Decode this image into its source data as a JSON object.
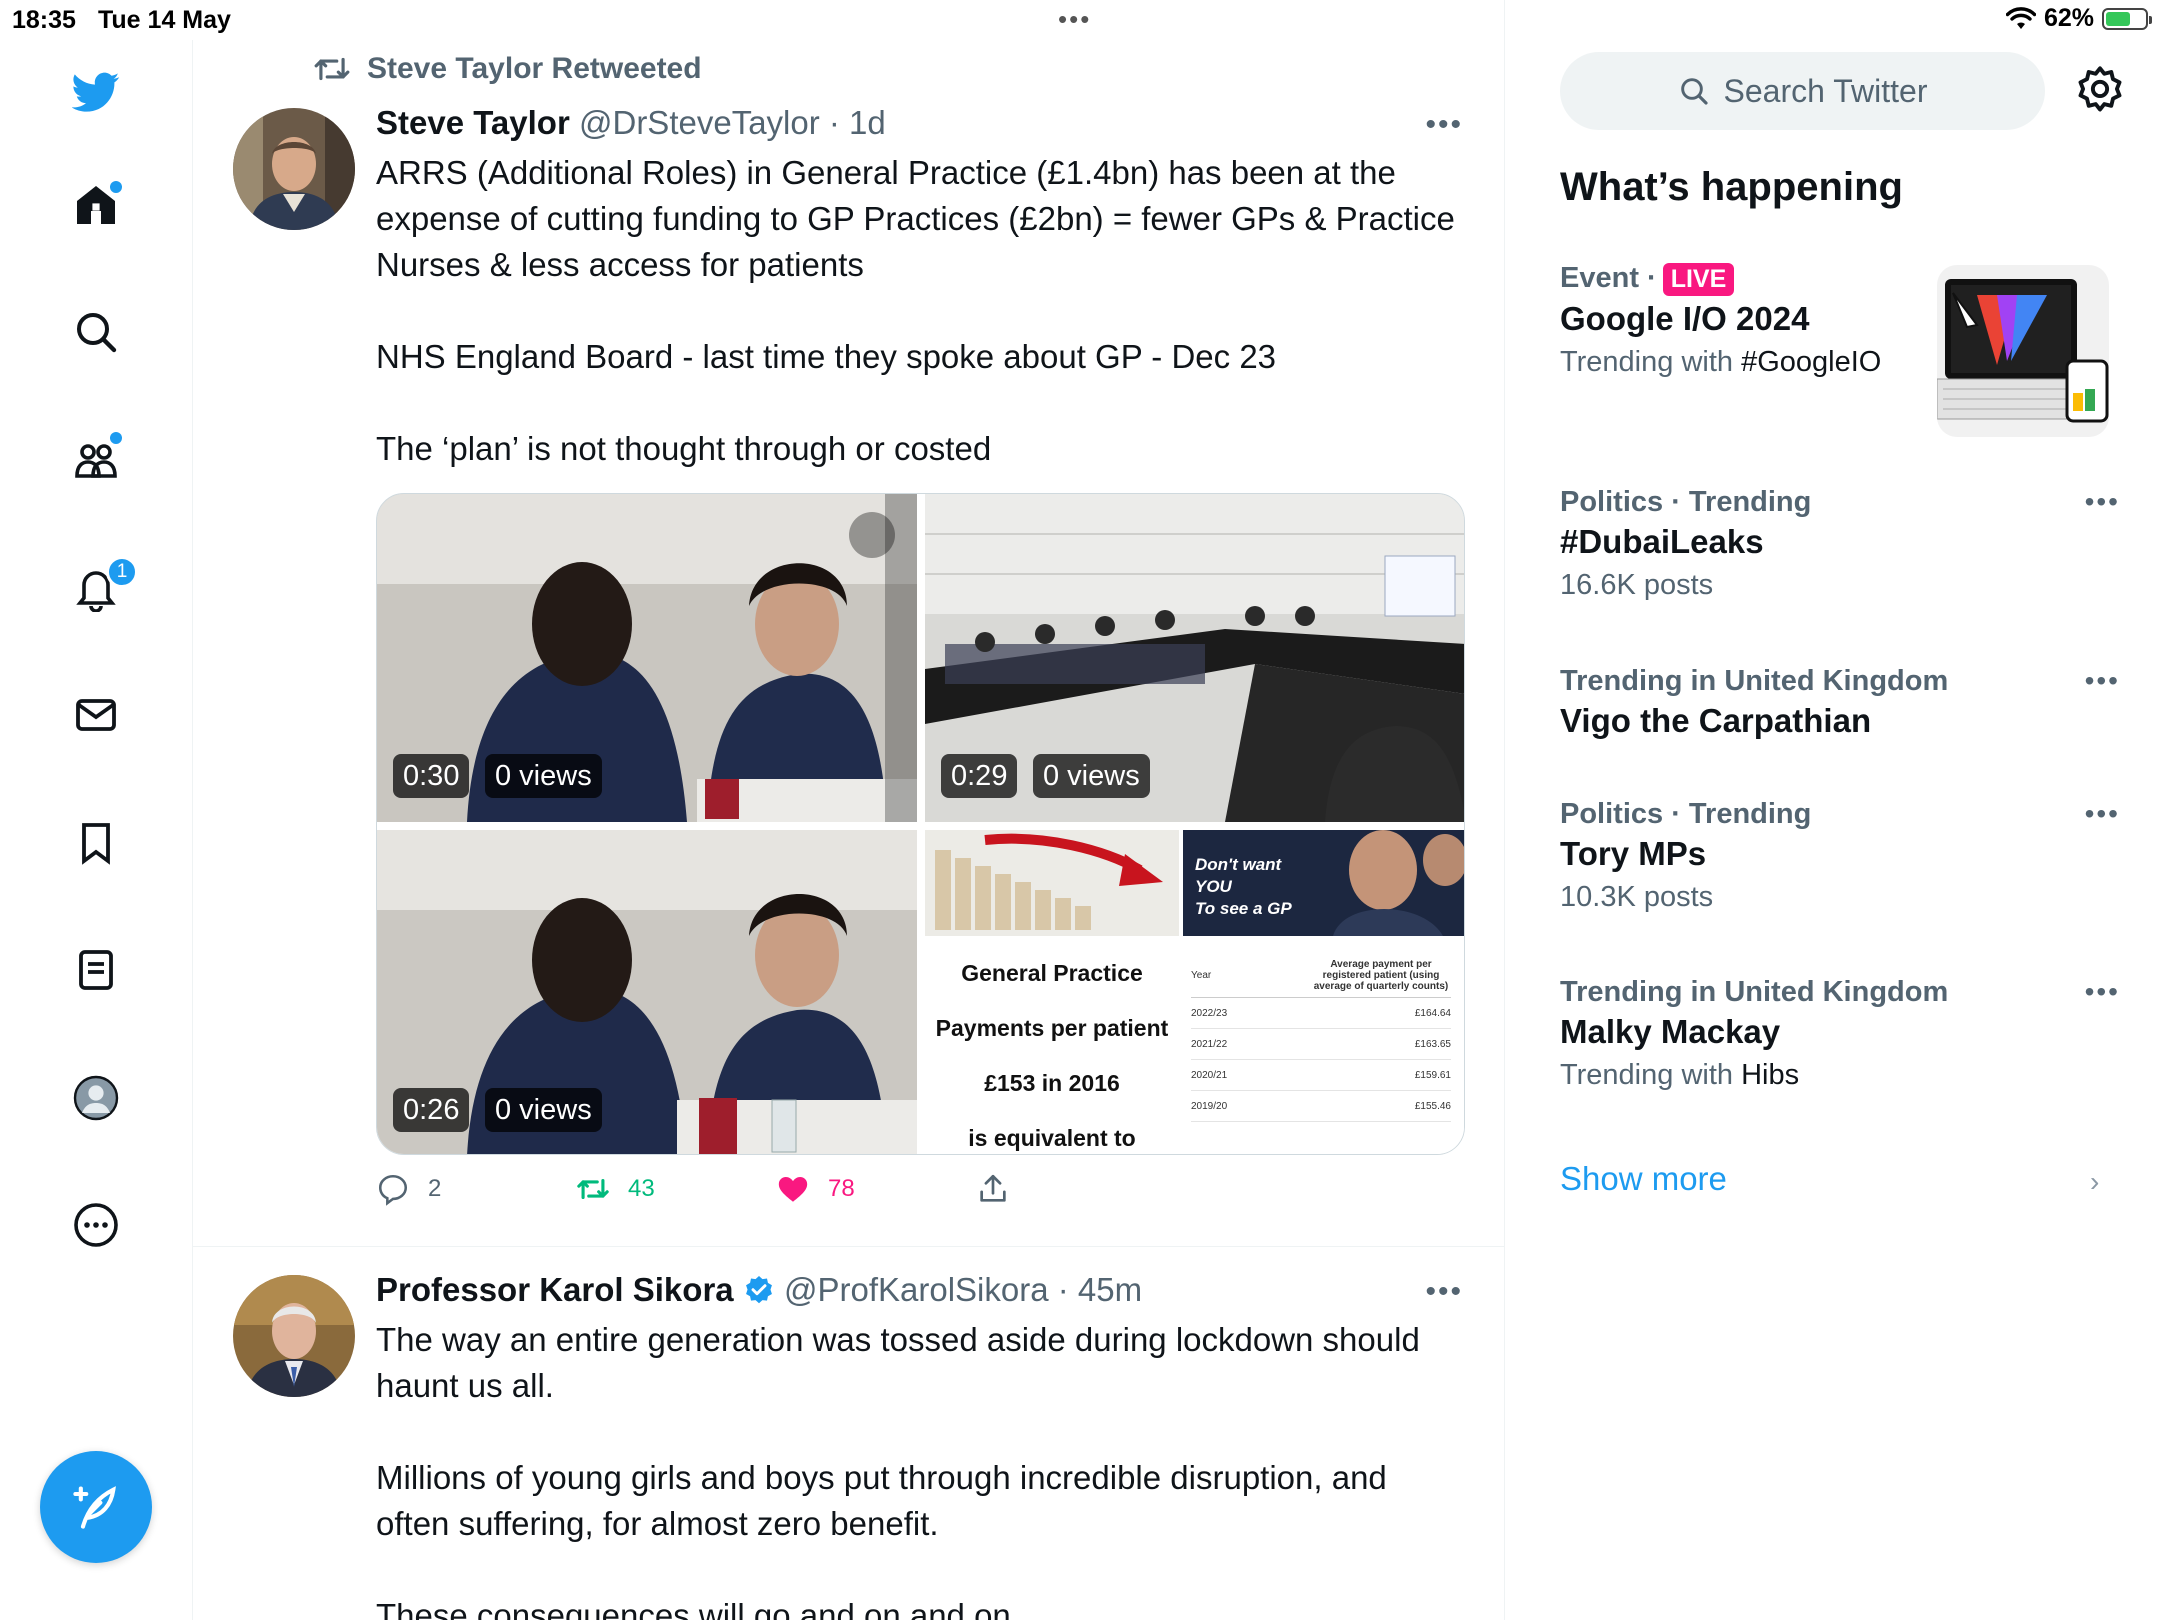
{
  "status_bar": {
    "time": "18:35",
    "date": "Tue 14 May",
    "battery": "62%",
    "battery_level": 0.62
  },
  "nav": {
    "items": [
      "twitter-logo",
      "home",
      "search",
      "communities",
      "notifications",
      "messages",
      "bookmarks",
      "lists",
      "profile",
      "more"
    ],
    "notifications_count": "1",
    "compose_label": "Compose"
  },
  "timeline": {
    "tweets": [
      {
        "retweeted_by": "Steve Taylor Retweeted",
        "name": "Steve Taylor",
        "handle": "@DrSteveTaylor",
        "time": "· 1d",
        "text": "ARRS (Additional Roles) in General Practice (£1.4bn) has been at the expense of cutting funding to GP Practices (£2bn) = fewer GPs & Practice Nurses & less access for patients\n\nNHS England Board - last time they spoke about GP - Dec 23\n\nThe ‘plan’ is not thought through or costed",
        "media": [
          {
            "duration": "0:30",
            "views": "0 views"
          },
          {
            "duration": "0:29",
            "views": "0 views"
          },
          {
            "duration": "0:26",
            "views": "0 views"
          },
          {
            "caption_lines": [
              "General Practice",
              "Payments per patient",
              "£153 in 2016",
              "is equivalent to"
            ],
            "overlay_text": [
              "Don't want",
              "YOU",
              "To see a GP"
            ],
            "table": {
              "headers": [
                "Year",
                "Average payment per registered patient (using average of quarterly counts)"
              ],
              "rows": [
                [
                  "2022/23",
                  "£164.64"
                ],
                [
                  "2021/22",
                  "£163.65"
                ],
                [
                  "2020/21",
                  "£159.61"
                ],
                [
                  "2019/20",
                  "£155.46"
                ]
              ]
            }
          }
        ],
        "replies": "2",
        "retweets": "43",
        "likes": "78"
      },
      {
        "name": "Professor Karol Sikora",
        "verified": true,
        "handle": "@ProfKarolSikora",
        "time": "· 45m",
        "text": "The way an entire generation was tossed aside during lockdown should haunt us all.\n\nMillions of young girls and boys put through incredible disruption, and often suffering, for almost zero benefit.\n\nThese consequences will go and on and on"
      }
    ]
  },
  "sidebar": {
    "search_placeholder": "Search Twitter",
    "whats_happening": "What’s happening",
    "trends": [
      {
        "category": "Event ·",
        "live": "LIVE",
        "title": "Google I/O 2024",
        "sub_prefix": "Trending with ",
        "sub_tag": "#GoogleIO"
      },
      {
        "category": "Politics · Trending",
        "title": "#DubaiLeaks",
        "sub": "16.6K posts"
      },
      {
        "category": "Trending in United Kingdom",
        "title": "Vigo the Carpathian"
      },
      {
        "category": "Politics · Trending",
        "title": "Tory MPs",
        "sub": "10.3K posts"
      },
      {
        "category": "Trending in United Kingdom",
        "title": "Malky Mackay",
        "sub_prefix": "Trending with ",
        "sub_tag": "Hibs"
      }
    ],
    "show_more": "Show more"
  },
  "colors": {
    "accent": "#1d9bf0",
    "like": "#f91880",
    "retweet": "#00ba7c",
    "muted": "#536471"
  }
}
